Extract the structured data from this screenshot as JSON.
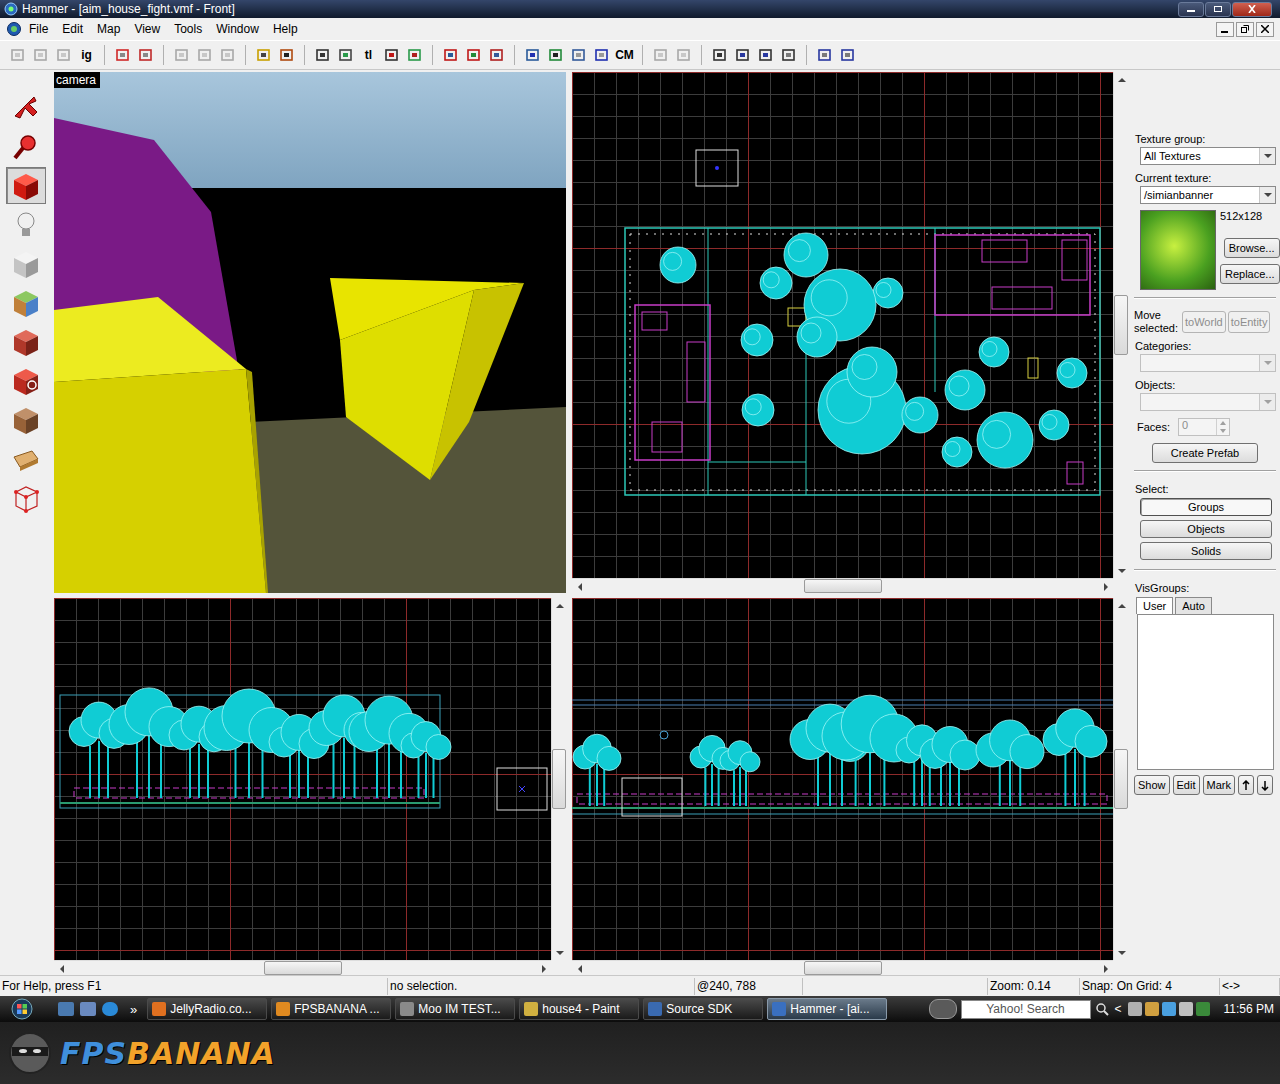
{
  "window": {
    "title": "Hammer - [aim_house_fight.vmf - Front]"
  },
  "menu": [
    "File",
    "Edit",
    "Map",
    "View",
    "Tools",
    "Window",
    "Help"
  ],
  "toolbar": [
    [
      {
        "kind": "icon",
        "disabled": true
      },
      {
        "kind": "icon",
        "disabled": true
      },
      {
        "kind": "icon",
        "disabled": true
      },
      {
        "kind": "text",
        "label": "ig",
        "disabled": false
      }
    ],
    [
      {
        "kind": "icon",
        "disabled": false
      },
      {
        "kind": "icon",
        "disabled": false
      }
    ],
    [
      {
        "kind": "icon",
        "disabled": true
      },
      {
        "kind": "icon",
        "disabled": true
      },
      {
        "kind": "icon",
        "disabled": true
      }
    ],
    [
      {
        "kind": "icon",
        "disabled": false
      },
      {
        "kind": "icon",
        "disabled": false
      }
    ],
    [
      {
        "kind": "icon",
        "disabled": false
      },
      {
        "kind": "icon",
        "disabled": false
      },
      {
        "kind": "text",
        "label": "tl",
        "disabled": false
      },
      {
        "kind": "icon",
        "disabled": false
      },
      {
        "kind": "icon",
        "disabled": false
      }
    ],
    [
      {
        "kind": "icon",
        "disabled": false
      },
      {
        "kind": "icon",
        "disabled": false
      },
      {
        "kind": "icon",
        "disabled": false
      }
    ],
    [
      {
        "kind": "icon",
        "disabled": false
      },
      {
        "kind": "icon",
        "disabled": false
      },
      {
        "kind": "icon",
        "disabled": false
      },
      {
        "kind": "icon",
        "disabled": false
      },
      {
        "kind": "text",
        "label": "CM",
        "disabled": false
      }
    ],
    [
      {
        "kind": "icon",
        "disabled": true
      },
      {
        "kind": "icon",
        "disabled": true
      }
    ],
    [
      {
        "kind": "icon",
        "disabled": false
      },
      {
        "kind": "icon",
        "disabled": false
      },
      {
        "kind": "icon",
        "disabled": false
      },
      {
        "kind": "icon",
        "disabled": false
      }
    ],
    [
      {
        "kind": "icon",
        "disabled": false
      },
      {
        "kind": "icon",
        "disabled": false
      }
    ]
  ],
  "tools": [
    {
      "kind": "selection",
      "selected": false
    },
    {
      "kind": "magnify",
      "selected": false
    },
    {
      "kind": "camera",
      "selected": true
    },
    {
      "kind": "entity",
      "selected": false
    },
    {
      "kind": "block",
      "selected": false
    },
    {
      "kind": "toolbar-texture",
      "selected": false
    },
    {
      "kind": "apply-texture",
      "selected": false
    },
    {
      "kind": "decal",
      "selected": false
    },
    {
      "kind": "overlay",
      "selected": false
    },
    {
      "kind": "clip",
      "selected": false
    },
    {
      "kind": "vertex",
      "selected": false
    }
  ],
  "viewports": [
    {
      "kind": "camera",
      "label": "camera"
    },
    {
      "kind": "top"
    },
    {
      "kind": "front"
    },
    {
      "kind": "side"
    }
  ],
  "texture_panel": {
    "group_label": "Texture group:",
    "group_value": "All Textures",
    "current_label": "Current texture:",
    "current_value": "/simianbanner",
    "size": "512x128",
    "browse": "Browse...",
    "replace": "Replace..."
  },
  "move_selected": {
    "label": "Move selected:",
    "buttons": [
      {
        "label": "toWorld",
        "disabled": true
      },
      {
        "label": "toEntity",
        "disabled": true
      }
    ]
  },
  "categories": {
    "label": "Categories:",
    "disabled": true
  },
  "objects": {
    "label": "Objects:",
    "disabled": true
  },
  "faces": {
    "label": "Faces:",
    "value": "0",
    "disabled": true
  },
  "create_prefab": "Create Prefab",
  "select": {
    "label": "Select:",
    "buttons": [
      {
        "label": "Groups",
        "selected": true
      },
      {
        "label": "Objects",
        "selected": false
      },
      {
        "label": "Solids",
        "selected": false
      }
    ]
  },
  "visgroups": {
    "label": "VisGroups:",
    "tabs": [
      {
        "label": "User",
        "selected": true
      },
      {
        "label": "Auto",
        "selected": false
      }
    ],
    "buttons": [
      "Show",
      "Edit",
      "Mark"
    ]
  },
  "status": [
    "For Help, press F1",
    "no selection.",
    "@240, 788",
    "Zoom: 0.14",
    "Snap: On Grid: 4",
    "<->"
  ],
  "taskbar": {
    "more": "»",
    "buttons": [
      {
        "label": "JellyRadio.co...",
        "active": false
      },
      {
        "label": "FPSBANANA ...",
        "active": false
      },
      {
        "label": "Moo IM TEST...",
        "active": false
      },
      {
        "label": "house4 - Paint",
        "active": false
      },
      {
        "label": "Source SDK",
        "active": false
      },
      {
        "label": "Hammer - [ai...",
        "active": true
      }
    ],
    "search": "Yahoo! Search",
    "tray_more": "<",
    "clock": "11:56 PM"
  },
  "watermark": [
    {
      "text": "FPS",
      "color": "#3f8fdc"
    },
    {
      "text": "BANANA",
      "color": "#f2a22a"
    }
  ]
}
